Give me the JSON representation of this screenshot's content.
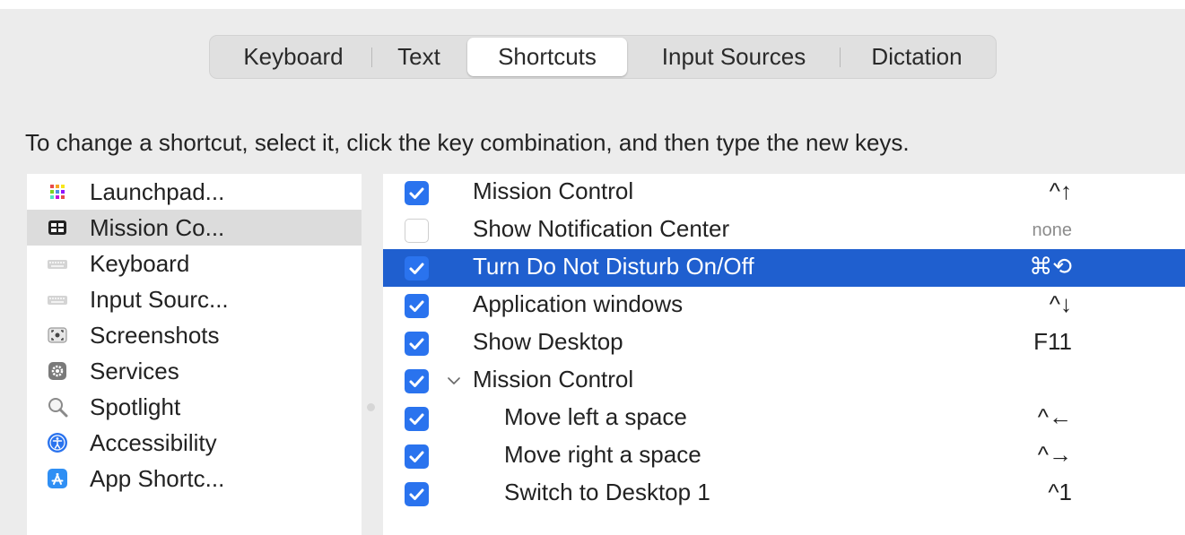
{
  "tabs": [
    {
      "label": "Keyboard",
      "active": false
    },
    {
      "label": "Text",
      "active": false
    },
    {
      "label": "Shortcuts",
      "active": true
    },
    {
      "label": "Input Sources",
      "active": false
    },
    {
      "label": "Dictation",
      "active": false
    }
  ],
  "instruction": "To change a shortcut, select it, click the key combination, and then type the new keys.",
  "sidebar": {
    "items": [
      {
        "label": "Launchpad...",
        "icon": "launchpad-icon",
        "selected": false
      },
      {
        "label": "Mission Co...",
        "icon": "mission-control-icon",
        "selected": true
      },
      {
        "label": "Keyboard",
        "icon": "keyboard-icon",
        "selected": false
      },
      {
        "label": "Input Sourc...",
        "icon": "input-sources-icon",
        "selected": false
      },
      {
        "label": "Screenshots",
        "icon": "screenshot-icon",
        "selected": false
      },
      {
        "label": "Services",
        "icon": "gear-icon",
        "selected": false
      },
      {
        "label": "Spotlight",
        "icon": "magnifier-icon",
        "selected": false
      },
      {
        "label": "Accessibility",
        "icon": "accessibility-icon",
        "selected": false
      },
      {
        "label": "App Shortc...",
        "icon": "app-store-icon",
        "selected": false
      }
    ]
  },
  "shortcuts": {
    "rows": [
      {
        "label": "Mission Control",
        "key": "^↑",
        "checked": true,
        "selected": false,
        "indent": 0
      },
      {
        "label": "Show Notification Center",
        "key": "none",
        "checked": false,
        "selected": false,
        "indent": 0
      },
      {
        "label": "Turn Do Not Disturb On/Off",
        "key": "⌘⟲",
        "checked": true,
        "selected": true,
        "indent": 0
      },
      {
        "label": "Application windows",
        "key": "^↓",
        "checked": true,
        "selected": false,
        "indent": 0
      },
      {
        "label": "Show Desktop",
        "key": "F11",
        "checked": true,
        "selected": false,
        "indent": 0
      },
      {
        "label": "Mission Control",
        "key": "",
        "checked": true,
        "selected": false,
        "indent": 0,
        "group": true
      },
      {
        "label": "Move left a space",
        "key": "^←",
        "checked": true,
        "selected": false,
        "indent": 1
      },
      {
        "label": "Move right a space",
        "key": "^→",
        "checked": true,
        "selected": false,
        "indent": 1
      },
      {
        "label": "Switch to Desktop 1",
        "key": "^1",
        "checked": true,
        "selected": false,
        "indent": 1
      }
    ]
  },
  "colors": {
    "accent": "#2a73ee",
    "selection": "#1f5fcf",
    "window_bg": "#ececec"
  }
}
